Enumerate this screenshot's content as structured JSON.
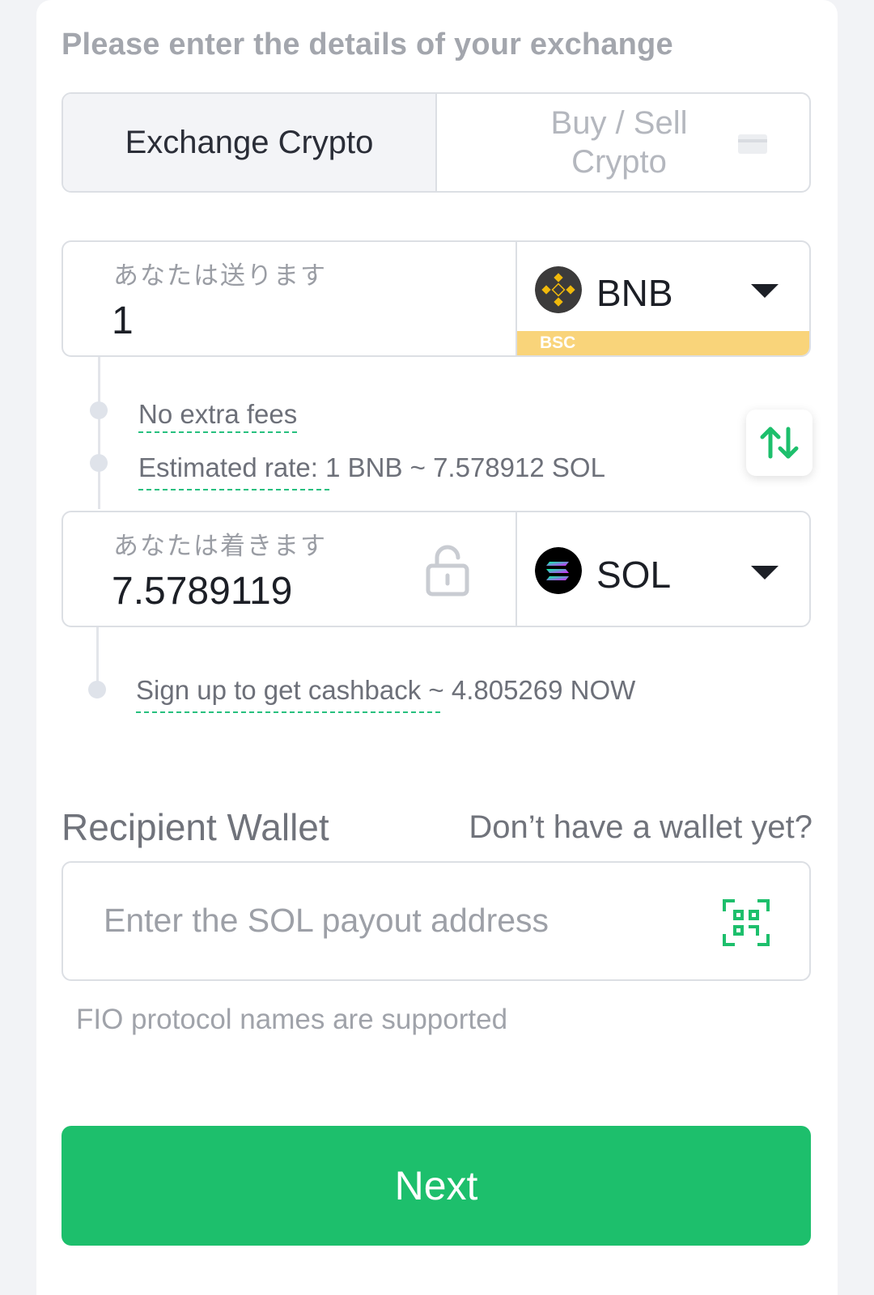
{
  "heading": "Please enter the details of your exchange",
  "tabs": [
    {
      "label": "Exchange Crypto",
      "active": true
    },
    {
      "label": "Buy / Sell Crypto",
      "active": false
    }
  ],
  "send": {
    "label": "あなたは送ります",
    "amount": "1",
    "currency": "BNB",
    "network": "BSC"
  },
  "info": {
    "fees": "No extra fees",
    "rate": "Estimated rate: 1 BNB ~ 7.578912 SOL"
  },
  "receive": {
    "label": "あなたは着きます",
    "amount": "7.5789119",
    "currency": "SOL"
  },
  "cashback": "Sign up to get cashback ~ 4.805269 NOW",
  "wallet": {
    "title": "Recipient Wallet",
    "no_wallet_link": "Don’t have a wallet yet?",
    "placeholder": "Enter the SOL payout address",
    "hint": "FIO protocol names are supported"
  },
  "next_label": "Next",
  "colors": {
    "accent": "#1dbf6c",
    "bsc_strip": "#f9d47a",
    "bnb_gold": "#f0b90b"
  }
}
